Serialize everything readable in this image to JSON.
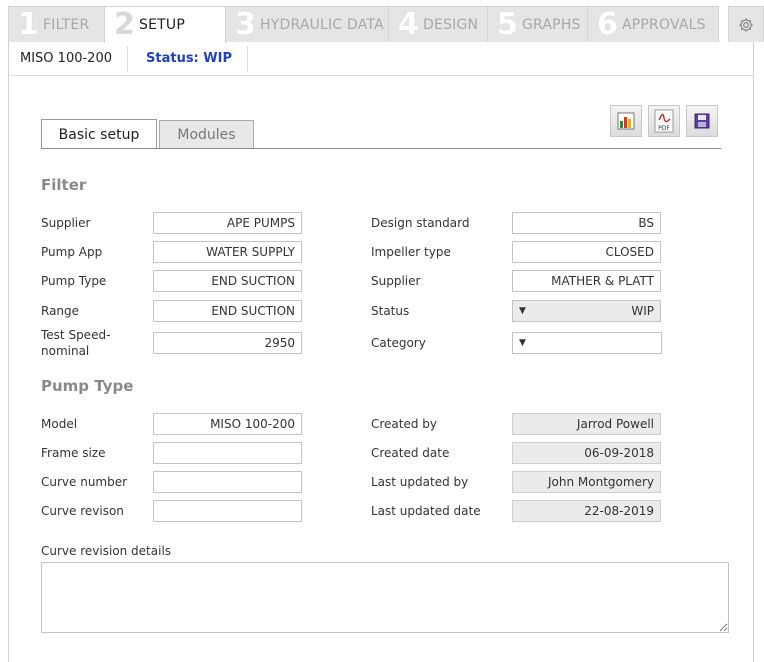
{
  "steps": [
    {
      "num": "1",
      "label": "FILTER"
    },
    {
      "num": "2",
      "label": "SETUP"
    },
    {
      "num": "3",
      "label": "HYDRAULIC DATA"
    },
    {
      "num": "4",
      "label": "DESIGN"
    },
    {
      "num": "5",
      "label": "GRAPHS"
    },
    {
      "num": "6",
      "label": "APPROVALS"
    }
  ],
  "subbar": {
    "model": "MISO 100-200",
    "status": "Status: WIP"
  },
  "tabs": {
    "basic": "Basic setup",
    "modules": "Modules"
  },
  "toolbar": {
    "pdf_label": "PDF"
  },
  "filter": {
    "title": "Filter",
    "supplier_label": "Supplier",
    "supplier": "APE PUMPS",
    "pump_app_label": "Pump App",
    "pump_app": "WATER SUPPLY",
    "pump_type_label": "Pump Type",
    "pump_type": "END SUCTION",
    "range_label": "Range",
    "range": "END SUCTION",
    "test_speed_label": "Test Speed-nominal",
    "test_speed": "2950",
    "design_standard_label": "Design standard",
    "design_standard": "BS",
    "impeller_label": "Impeller type",
    "impeller": "CLOSED",
    "supplier2_label": "Supplier",
    "supplier2": "MATHER & PLATT",
    "status_label": "Status",
    "status": "WIP",
    "category_label": "Category",
    "category": ""
  },
  "pump_type": {
    "title": "Pump Type",
    "model_label": "Model",
    "model": "MISO 100-200",
    "frame_label": "Frame size",
    "frame": "",
    "curve_number_label": "Curve number",
    "curve_number": "",
    "curve_revision_label": "Curve revison",
    "curve_revision": "",
    "created_by_label": "Created by",
    "created_by": "Jarrod Powell",
    "created_date_label": "Created date",
    "created_date": "06-09-2018",
    "updated_by_label": "Last updated by",
    "updated_by": "John Montgomery",
    "updated_date_label": "Last updated date",
    "updated_date": "22-08-2019"
  },
  "details": {
    "label": "Curve revision details",
    "value": ""
  },
  "colors": {
    "status": "#1f3fbf",
    "section": "#8a8a8a"
  }
}
